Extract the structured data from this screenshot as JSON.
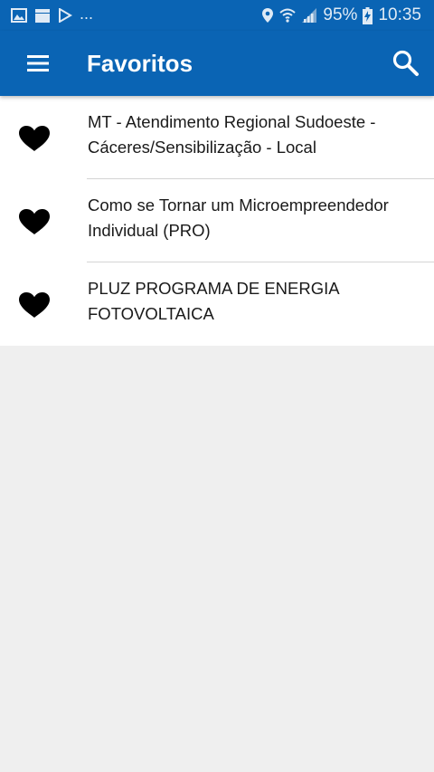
{
  "status_bar": {
    "overflow": "...",
    "battery": "95%",
    "time": "10:35"
  },
  "app_bar": {
    "title": "Favoritos",
    "menu_icon": "hamburger-menu-icon",
    "search_icon": "search-icon"
  },
  "favorites": [
    {
      "label": "MT - Atendimento Regional Sudoeste - Cáceres/Sensibilização - Local",
      "icon": "heart-icon"
    },
    {
      "label": "Como se Tornar um Microempreendedor Individual (PRO)",
      "icon": "heart-icon"
    },
    {
      "label": "PLUZ PROGRAMA DE ENERGIA FOTOVOLTAICA",
      "icon": "heart-icon"
    }
  ],
  "colors": {
    "primary": "#0a64b4",
    "background": "#efefef",
    "list_background": "#ffffff"
  }
}
